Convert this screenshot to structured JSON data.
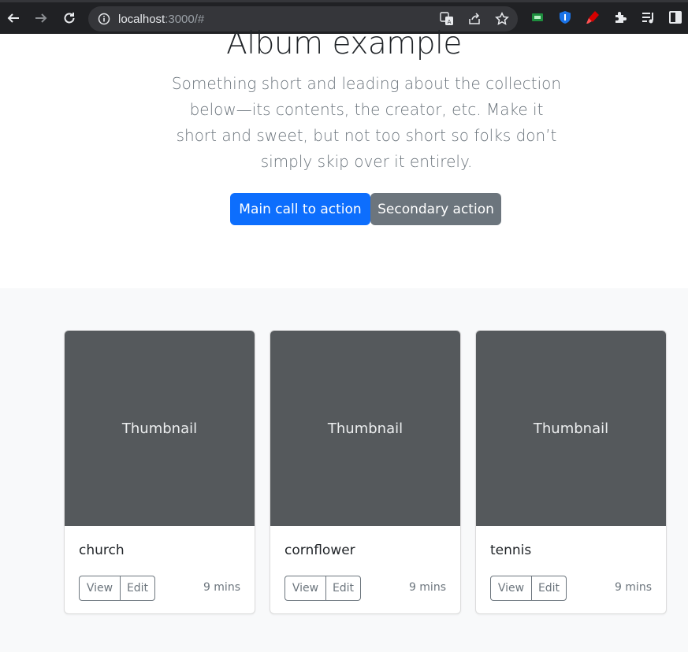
{
  "browser": {
    "url_host": "localhost",
    "url_rest": ":3000/#",
    "icons": [
      "back-arrow-icon",
      "forward-arrow-icon",
      "reload-icon",
      "site-info-icon",
      "translate-icon",
      "share-icon",
      "bookmark-star-icon",
      "extension-screen-icon",
      "bitwarden-shield-icon",
      "highlighter-icon",
      "extensions-puzzle-icon",
      "media-queue-icon",
      "side-panel-icon"
    ]
  },
  "hero": {
    "title": "Album example",
    "lead": "Something short and leading about the collection below—its contents, the creator, etc. Make it short and sweet, but not too short so folks don’t simply skip over it entirely.",
    "primary_button": "Main call to action",
    "secondary_button": "Secondary action"
  },
  "cards": [
    {
      "thumbnail": "Thumbnail",
      "text": "church",
      "view": "View",
      "edit": "Edit",
      "time": "9 mins"
    },
    {
      "thumbnail": "Thumbnail",
      "text": "cornflower",
      "view": "View",
      "edit": "Edit",
      "time": "9 mins"
    },
    {
      "thumbnail": "Thumbnail",
      "text": "tennis",
      "view": "View",
      "edit": "Edit",
      "time": "9 mins"
    }
  ],
  "colors": {
    "primary": "#0d6efd",
    "secondary": "#6c757d",
    "thumbnail_bg": "#55595c",
    "album_bg": "#f8f9fa"
  }
}
